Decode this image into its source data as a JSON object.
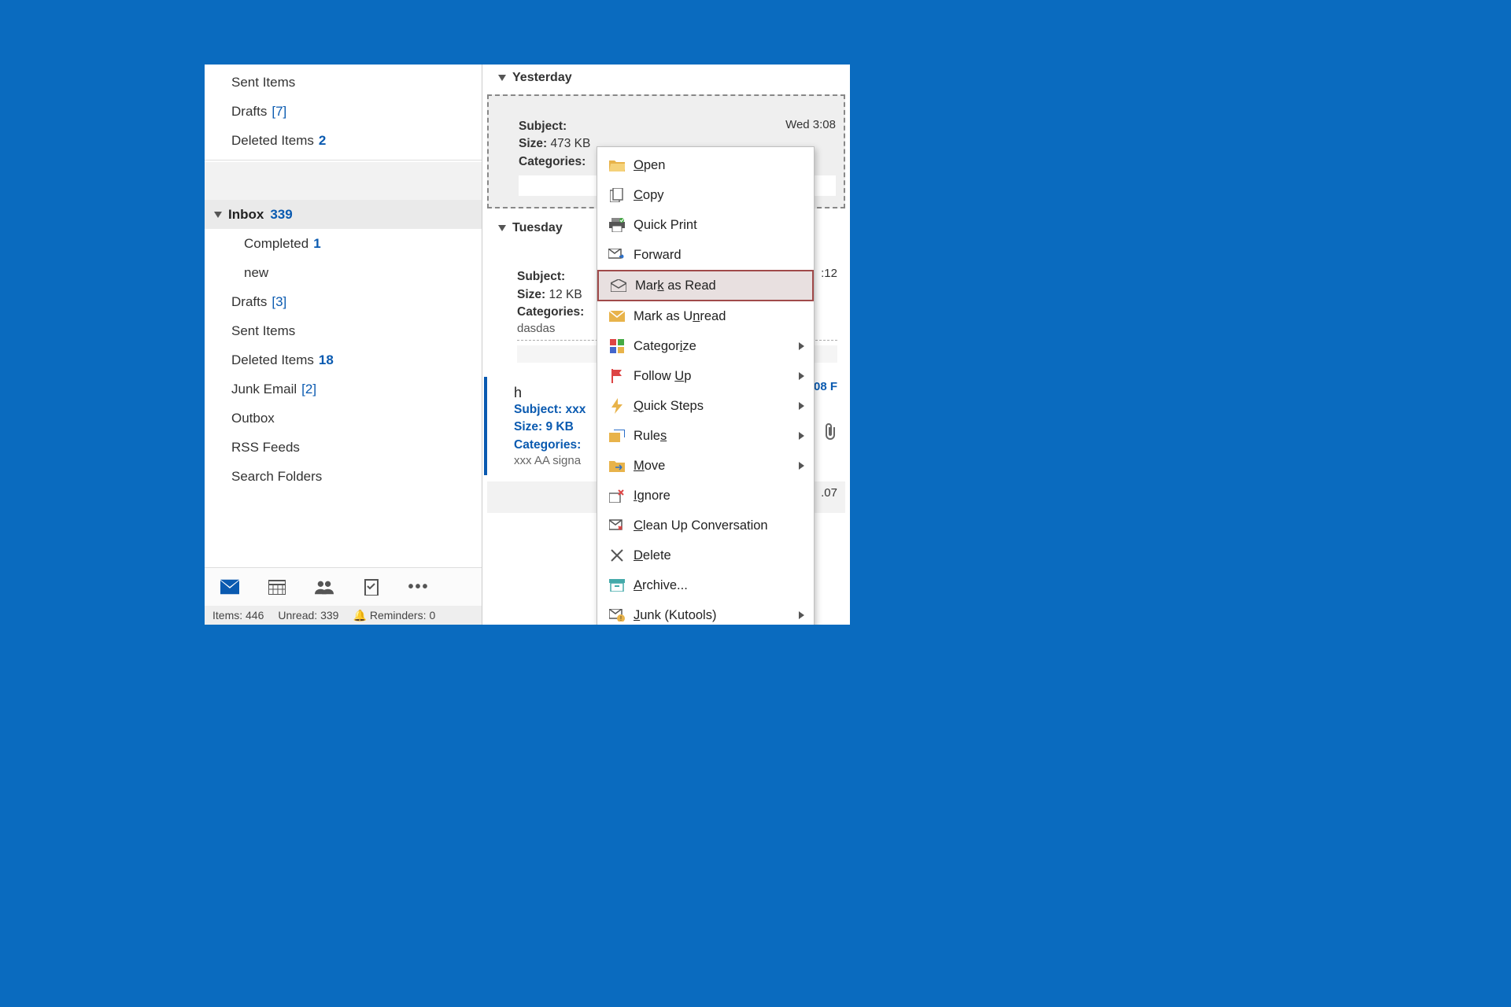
{
  "sidebar": {
    "top_folders": [
      {
        "label": "Sent Items",
        "count": ""
      },
      {
        "label": "Drafts",
        "count": "[7]",
        "bracket": true
      },
      {
        "label": "Deleted Items",
        "count": "2"
      }
    ],
    "inbox": {
      "label": "Inbox",
      "count": "339"
    },
    "sub": [
      {
        "label": "Completed",
        "count": "1"
      },
      {
        "label": "new",
        "count": ""
      }
    ],
    "folders": [
      {
        "label": "Drafts",
        "count": "[3]",
        "bracket": true
      },
      {
        "label": "Sent Items",
        "count": ""
      },
      {
        "label": "Deleted Items",
        "count": "18"
      },
      {
        "label": "Junk Email",
        "count": "[2]",
        "bracket": true
      },
      {
        "label": "Outbox",
        "count": ""
      },
      {
        "label": "RSS Feeds",
        "count": ""
      },
      {
        "label": "Search Folders",
        "count": ""
      }
    ]
  },
  "status": {
    "items_label": "Items:",
    "items": "446",
    "unread_label": "Unread:",
    "unread": "339",
    "reminders_label": "Reminders:",
    "reminders": "0"
  },
  "mail": {
    "groups": {
      "yesterday": "Yesterday",
      "tuesday": "Tuesday"
    },
    "card1": {
      "time": "Wed 3:08",
      "subject_lbl": "Subject:",
      "size_lbl": "Size:",
      "size": "473 KB",
      "categories_lbl": "Categories:"
    },
    "card2": {
      "time": ":12",
      "subject_lbl": "Subject:",
      "size_lbl": "Size:",
      "size": "12 KB",
      "categories_lbl": "Categories:",
      "extra": "dasdas"
    },
    "card3": {
      "sender": "h",
      "time": "08 F",
      "subject_lbl": "Subject:",
      "subject": "xxx",
      "size_lbl": "Size:",
      "size": "9 KB",
      "categories_lbl": "Categories:",
      "extra": "xxx  AA signa"
    },
    "card4": {
      "time": ".07"
    }
  },
  "menu": {
    "open": "Open",
    "copy": "Copy",
    "quickprint": "Quick Print",
    "forward": "Forward",
    "markread": "Mark as Read",
    "markunread": "Mark as Unread",
    "categorize": "Categorize",
    "followup": "Follow Up",
    "quicksteps": "Quick Steps",
    "rules": "Rules",
    "move": "Move",
    "ignore": "Ignore",
    "cleanup": "Clean Up Conversation",
    "delete": "Delete",
    "archive": "Archive...",
    "junk": "Junk (Kutools)"
  }
}
